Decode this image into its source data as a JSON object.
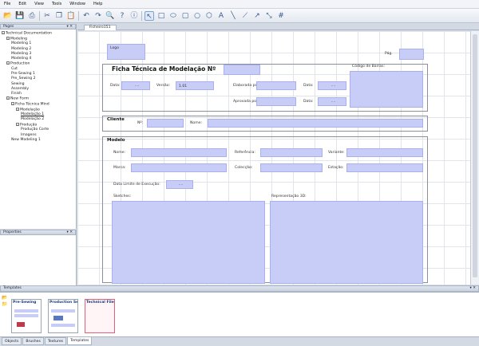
{
  "menu": [
    "File",
    "Edit",
    "View",
    "Tools",
    "Window",
    "Help"
  ],
  "toolbar_icons": [
    "open-folder-icon",
    "save-icon",
    "print-icon",
    "cut-icon",
    "copy-icon",
    "paste-icon",
    "undo-icon",
    "redo-icon",
    "zoom-icon",
    "help-icon",
    "info-icon",
    "pointer-icon",
    "rectangle-icon",
    "ellipse-icon",
    "round-rect-icon",
    "circle-icon",
    "hexagon-icon",
    "text-icon",
    "line-icon",
    "polyline-icon",
    "arrow-icon",
    "dimension-icon",
    "grid-icon"
  ],
  "panels": {
    "pages": "Pages",
    "properties": "Properties",
    "templates": "Templates",
    "pin": "▾ ✕"
  },
  "tree": [
    {
      "label": "Technical Documentation",
      "level": 0,
      "box": "-"
    },
    {
      "label": "Modeling",
      "level": 1,
      "box": "-"
    },
    {
      "label": "Modeling 1",
      "level": 2
    },
    {
      "label": "Modeling 2",
      "level": 2
    },
    {
      "label": "Modeling 3",
      "level": 2
    },
    {
      "label": "Modeling 4",
      "level": 2
    },
    {
      "label": "Production",
      "level": 1,
      "box": "-"
    },
    {
      "label": "Cut",
      "level": 2
    },
    {
      "label": "Pre-Sewing 1",
      "level": 2
    },
    {
      "label": "Pre_Sewing 2",
      "level": 2
    },
    {
      "label": "Sewing",
      "level": 2
    },
    {
      "label": "Assembly",
      "level": 2
    },
    {
      "label": "Finish",
      "level": 2
    },
    {
      "label": "New Form",
      "level": 1,
      "box": "-"
    },
    {
      "label": "Ficha Técnica Mind",
      "level": 2,
      "box": "-"
    },
    {
      "label": "Modelação",
      "level": 3,
      "box": "-"
    },
    {
      "label": "Modelação 1",
      "level": 4,
      "link": true
    },
    {
      "label": "Modelação 2",
      "level": 4
    },
    {
      "label": "Produção",
      "level": 3,
      "box": "-"
    },
    {
      "label": "Produção Corte",
      "level": 4
    },
    {
      "label": "Imagens",
      "level": 4
    },
    {
      "label": "New Modeling 1",
      "level": 2
    }
  ],
  "doc_tab": "Ficheiro151",
  "form": {
    "logo": "Logo",
    "pag": "Pág.",
    "title": "Ficha Técnica de Modelação Nº",
    "codigo_barras": "Código de Barras:",
    "data": "Data:",
    "date_value": "-   -",
    "versao": "Versão:",
    "versao_value": "1.01",
    "elaborado": "Elaborada por:",
    "aprovado": "Aprovada por:",
    "cliente": "Cliente",
    "nr": "Nº:",
    "nome": "Nome:",
    "modelo": "Modelo",
    "referencia": "Referência:",
    "variante": "Variante:",
    "marca": "Marca:",
    "coleccao": "Colecção:",
    "estacao": "Estação:",
    "data_limite": "Data Limite de Execução:",
    "sketches": "Sketches:",
    "representacao": "Representação 3D:"
  },
  "templates": [
    {
      "name": "Pre-Sewing"
    },
    {
      "name": "Production Se"
    },
    {
      "name": "Technical File"
    }
  ],
  "bottom_tabs": [
    "Objects",
    "Brushes",
    "Textures",
    "Templates"
  ],
  "colors": {
    "field": "#c7cdf7",
    "accent": "#3a5a8a"
  }
}
